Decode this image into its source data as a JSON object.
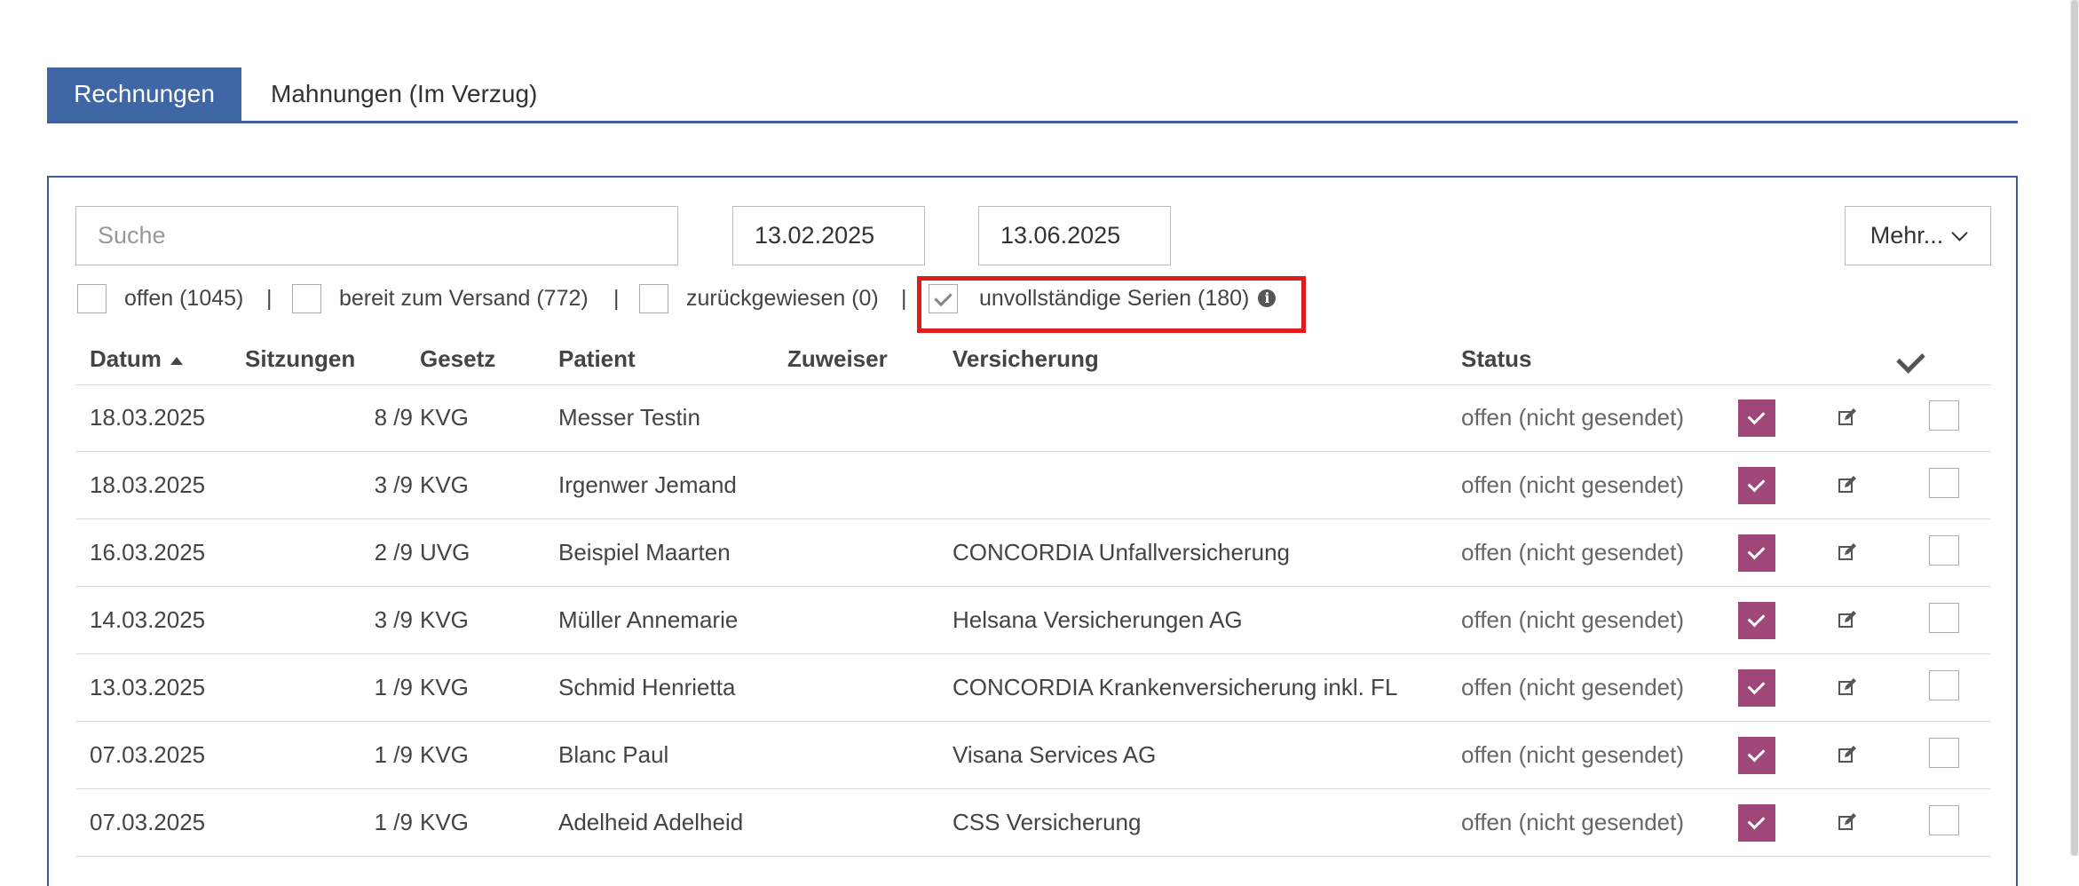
{
  "tabs": [
    {
      "label": "Rechnungen",
      "active": true
    },
    {
      "label": "Mahnungen (Im Verzug)",
      "active": false
    }
  ],
  "search": {
    "placeholder": "Suche",
    "value": ""
  },
  "date_from": "13.02.2025",
  "date_to": "13.06.2025",
  "more_label": "Mehr...",
  "filters": [
    {
      "label": "offen (1045)",
      "checked": false
    },
    {
      "label": "bereit zum Versand (772)",
      "checked": false
    },
    {
      "label": "zurückgewiesen (0)",
      "checked": false
    },
    {
      "label": "unvollständige Serien (180)",
      "checked": true
    }
  ],
  "separator": "|",
  "info_icon": "info-circle-icon",
  "columns": {
    "datum": "Datum",
    "sitzungen": "Sitzungen",
    "gesetz": "Gesetz",
    "patient": "Patient",
    "zuweiser": "Zuweiser",
    "versicherung": "Versicherung",
    "status": "Status"
  },
  "rows": [
    {
      "datum": "18.03.2025",
      "sitzungen": "8 /9",
      "gesetz": "KVG",
      "patient": "Messer Testin",
      "zuweiser": "",
      "versicherung": "",
      "status": "offen (nicht gesendet)"
    },
    {
      "datum": "18.03.2025",
      "sitzungen": "3 /9",
      "gesetz": "KVG",
      "patient": "Irgenwer Jemand",
      "zuweiser": "",
      "versicherung": "",
      "status": "offen (nicht gesendet)"
    },
    {
      "datum": "16.03.2025",
      "sitzungen": "2 /9",
      "gesetz": "UVG",
      "patient": "Beispiel Maarten",
      "zuweiser": "",
      "versicherung": "CONCORDIA Unfallversicherung",
      "status": "offen (nicht gesendet)"
    },
    {
      "datum": "14.03.2025",
      "sitzungen": "3 /9",
      "gesetz": "KVG",
      "patient": "Müller Annemarie",
      "zuweiser": "",
      "versicherung": "Helsana Versicherungen AG",
      "status": "offen (nicht gesendet)"
    },
    {
      "datum": "13.03.2025",
      "sitzungen": "1 /9",
      "gesetz": "KVG",
      "patient": "Schmid Henrietta",
      "zuweiser": "",
      "versicherung": "CONCORDIA Krankenversicherung inkl. FL",
      "status": "offen (nicht gesendet)"
    },
    {
      "datum": "07.03.2025",
      "sitzungen": "1 /9",
      "gesetz": "KVG",
      "patient": "Blanc Paul",
      "zuweiser": "",
      "versicherung": "Visana Services AG",
      "status": "offen (nicht gesendet)"
    },
    {
      "datum": "07.03.2025",
      "sitzungen": "1 /9",
      "gesetz": "KVG",
      "patient": "Adelheid Adelheid",
      "zuweiser": "",
      "versicherung": "CSS Versicherung",
      "status": "offen (nicht gesendet)"
    }
  ],
  "colors": {
    "tab_active": "#4067a5",
    "border": "#3f5d98",
    "approve": "#a0477a",
    "highlight": "#e01b1b"
  }
}
